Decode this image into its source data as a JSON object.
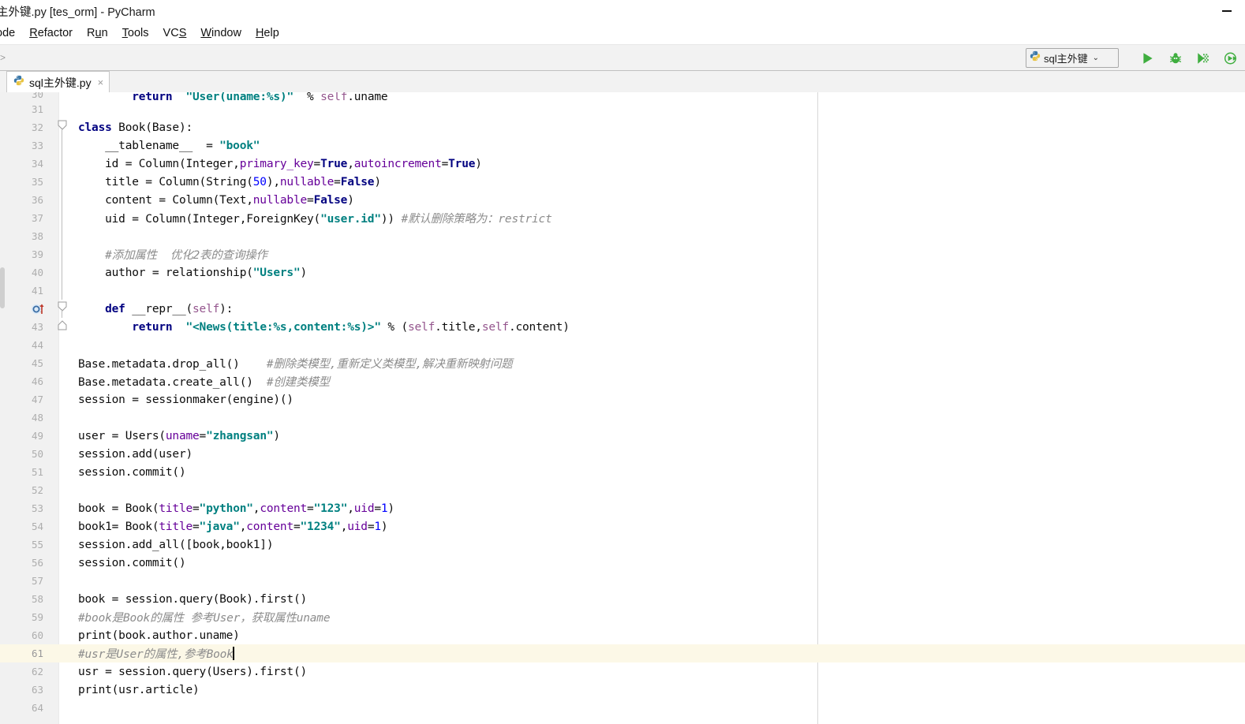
{
  "window": {
    "title": "主外键.py [tes_orm] - PyCharm",
    "minimize_label": "Minimize"
  },
  "menubar": {
    "items": [
      {
        "pre": "",
        "mn": "",
        "post": "ode",
        "name": "menu-code"
      },
      {
        "pre": "",
        "mn": "R",
        "post": "efactor",
        "name": "menu-refactor"
      },
      {
        "pre": "R",
        "mn": "u",
        "post": "n",
        "name": "menu-run"
      },
      {
        "pre": "",
        "mn": "T",
        "post": "ools",
        "name": "menu-tools"
      },
      {
        "pre": "VC",
        "mn": "S",
        "post": "",
        "name": "menu-vcs"
      },
      {
        "pre": "",
        "mn": "W",
        "post": "indow",
        "name": "menu-window"
      },
      {
        "pre": "",
        "mn": "H",
        "post": "elp",
        "name": "menu-help"
      }
    ]
  },
  "toolbar": {
    "breadcrumb": ">",
    "run_config_label": "sql主外键",
    "chevron": "⌄",
    "icons": [
      {
        "name": "run-icon",
        "title": "Run"
      },
      {
        "name": "debug-icon",
        "title": "Debug"
      },
      {
        "name": "coverage-icon",
        "title": "Run with Coverage"
      },
      {
        "name": "profile-icon",
        "title": "Profile"
      }
    ]
  },
  "tabs": [
    {
      "label": "sql主外键.py",
      "close": "×",
      "active": true
    }
  ],
  "editor": {
    "first_visible_line": 30,
    "current_line": 61,
    "right_margin_column_guide": true,
    "lines": [
      {
        "n": 30,
        "text": "        return  \"User(uname:%s)\"  % self.uname",
        "clipped": true
      },
      {
        "n": 31,
        "text": ""
      },
      {
        "n": 32,
        "text": "class Book(Base):"
      },
      {
        "n": 33,
        "text": "    __tablename__  = \"book\""
      },
      {
        "n": 34,
        "text": "    id = Column(Integer,primary_key=True,autoincrement=True)"
      },
      {
        "n": 35,
        "text": "    title = Column(String(50),nullable=False)"
      },
      {
        "n": 36,
        "text": "    content = Column(Text,nullable=False)"
      },
      {
        "n": 37,
        "text": "    uid = Column(Integer,ForeignKey(\"user.id\")) #默认删除策略为：restrict"
      },
      {
        "n": 38,
        "text": ""
      },
      {
        "n": 39,
        "text": "    #添加属性  优化2表的查询操作"
      },
      {
        "n": 40,
        "text": "    author = relationship(\"Users\")"
      },
      {
        "n": 41,
        "text": ""
      },
      {
        "n": 42,
        "text": "    def __repr__(self):"
      },
      {
        "n": 43,
        "text": "        return  \"<News(title:%s,content:%s)>\" % (self.title,self.content)"
      },
      {
        "n": 44,
        "text": ""
      },
      {
        "n": 45,
        "text": "Base.metadata.drop_all()    #删除类模型,重新定义类模型,解决重新映射问题"
      },
      {
        "n": 46,
        "text": "Base.metadata.create_all()  #创建类模型"
      },
      {
        "n": 47,
        "text": "session = sessionmaker(engine)()"
      },
      {
        "n": 48,
        "text": ""
      },
      {
        "n": 49,
        "text": "user = Users(uname=\"zhangsan\")"
      },
      {
        "n": 50,
        "text": "session.add(user)"
      },
      {
        "n": 51,
        "text": "session.commit()"
      },
      {
        "n": 52,
        "text": ""
      },
      {
        "n": 53,
        "text": "book = Book(title=\"python\",content=\"123\",uid=1)"
      },
      {
        "n": 54,
        "text": "book1= Book(title=\"java\",content=\"1234\",uid=1)"
      },
      {
        "n": 55,
        "text": "session.add_all([book,book1])"
      },
      {
        "n": 56,
        "text": "session.commit()"
      },
      {
        "n": 57,
        "text": ""
      },
      {
        "n": 58,
        "text": "book = session.query(Book).first()"
      },
      {
        "n": 59,
        "text": "#book是Book的属性 参考User，获取属性uname"
      },
      {
        "n": 60,
        "text": "print(book.author.uname)"
      },
      {
        "n": 61,
        "text": "#usr是User的属性,参考Book",
        "current": true,
        "cursor_at_end": true
      },
      {
        "n": 62,
        "text": "usr = session.query(Users).first()"
      },
      {
        "n": 63,
        "text": "print(usr.article)"
      },
      {
        "n": 64,
        "text": ""
      }
    ],
    "gutter_markers": [
      {
        "line": 42,
        "name": "override-method-icon",
        "glyph": "O"
      }
    ]
  },
  "colors": {
    "keyword": "#000080",
    "string": "#008080",
    "number": "#0000ff",
    "comment": "#8c8c8c",
    "kwarg": "#660099",
    "self": "#94558d",
    "current_line_bg": "#fcf8e7",
    "gutter_bg": "#f1f1f1",
    "toolbar_bg": "#f2f2f2",
    "run_green": "#3fae3f"
  }
}
